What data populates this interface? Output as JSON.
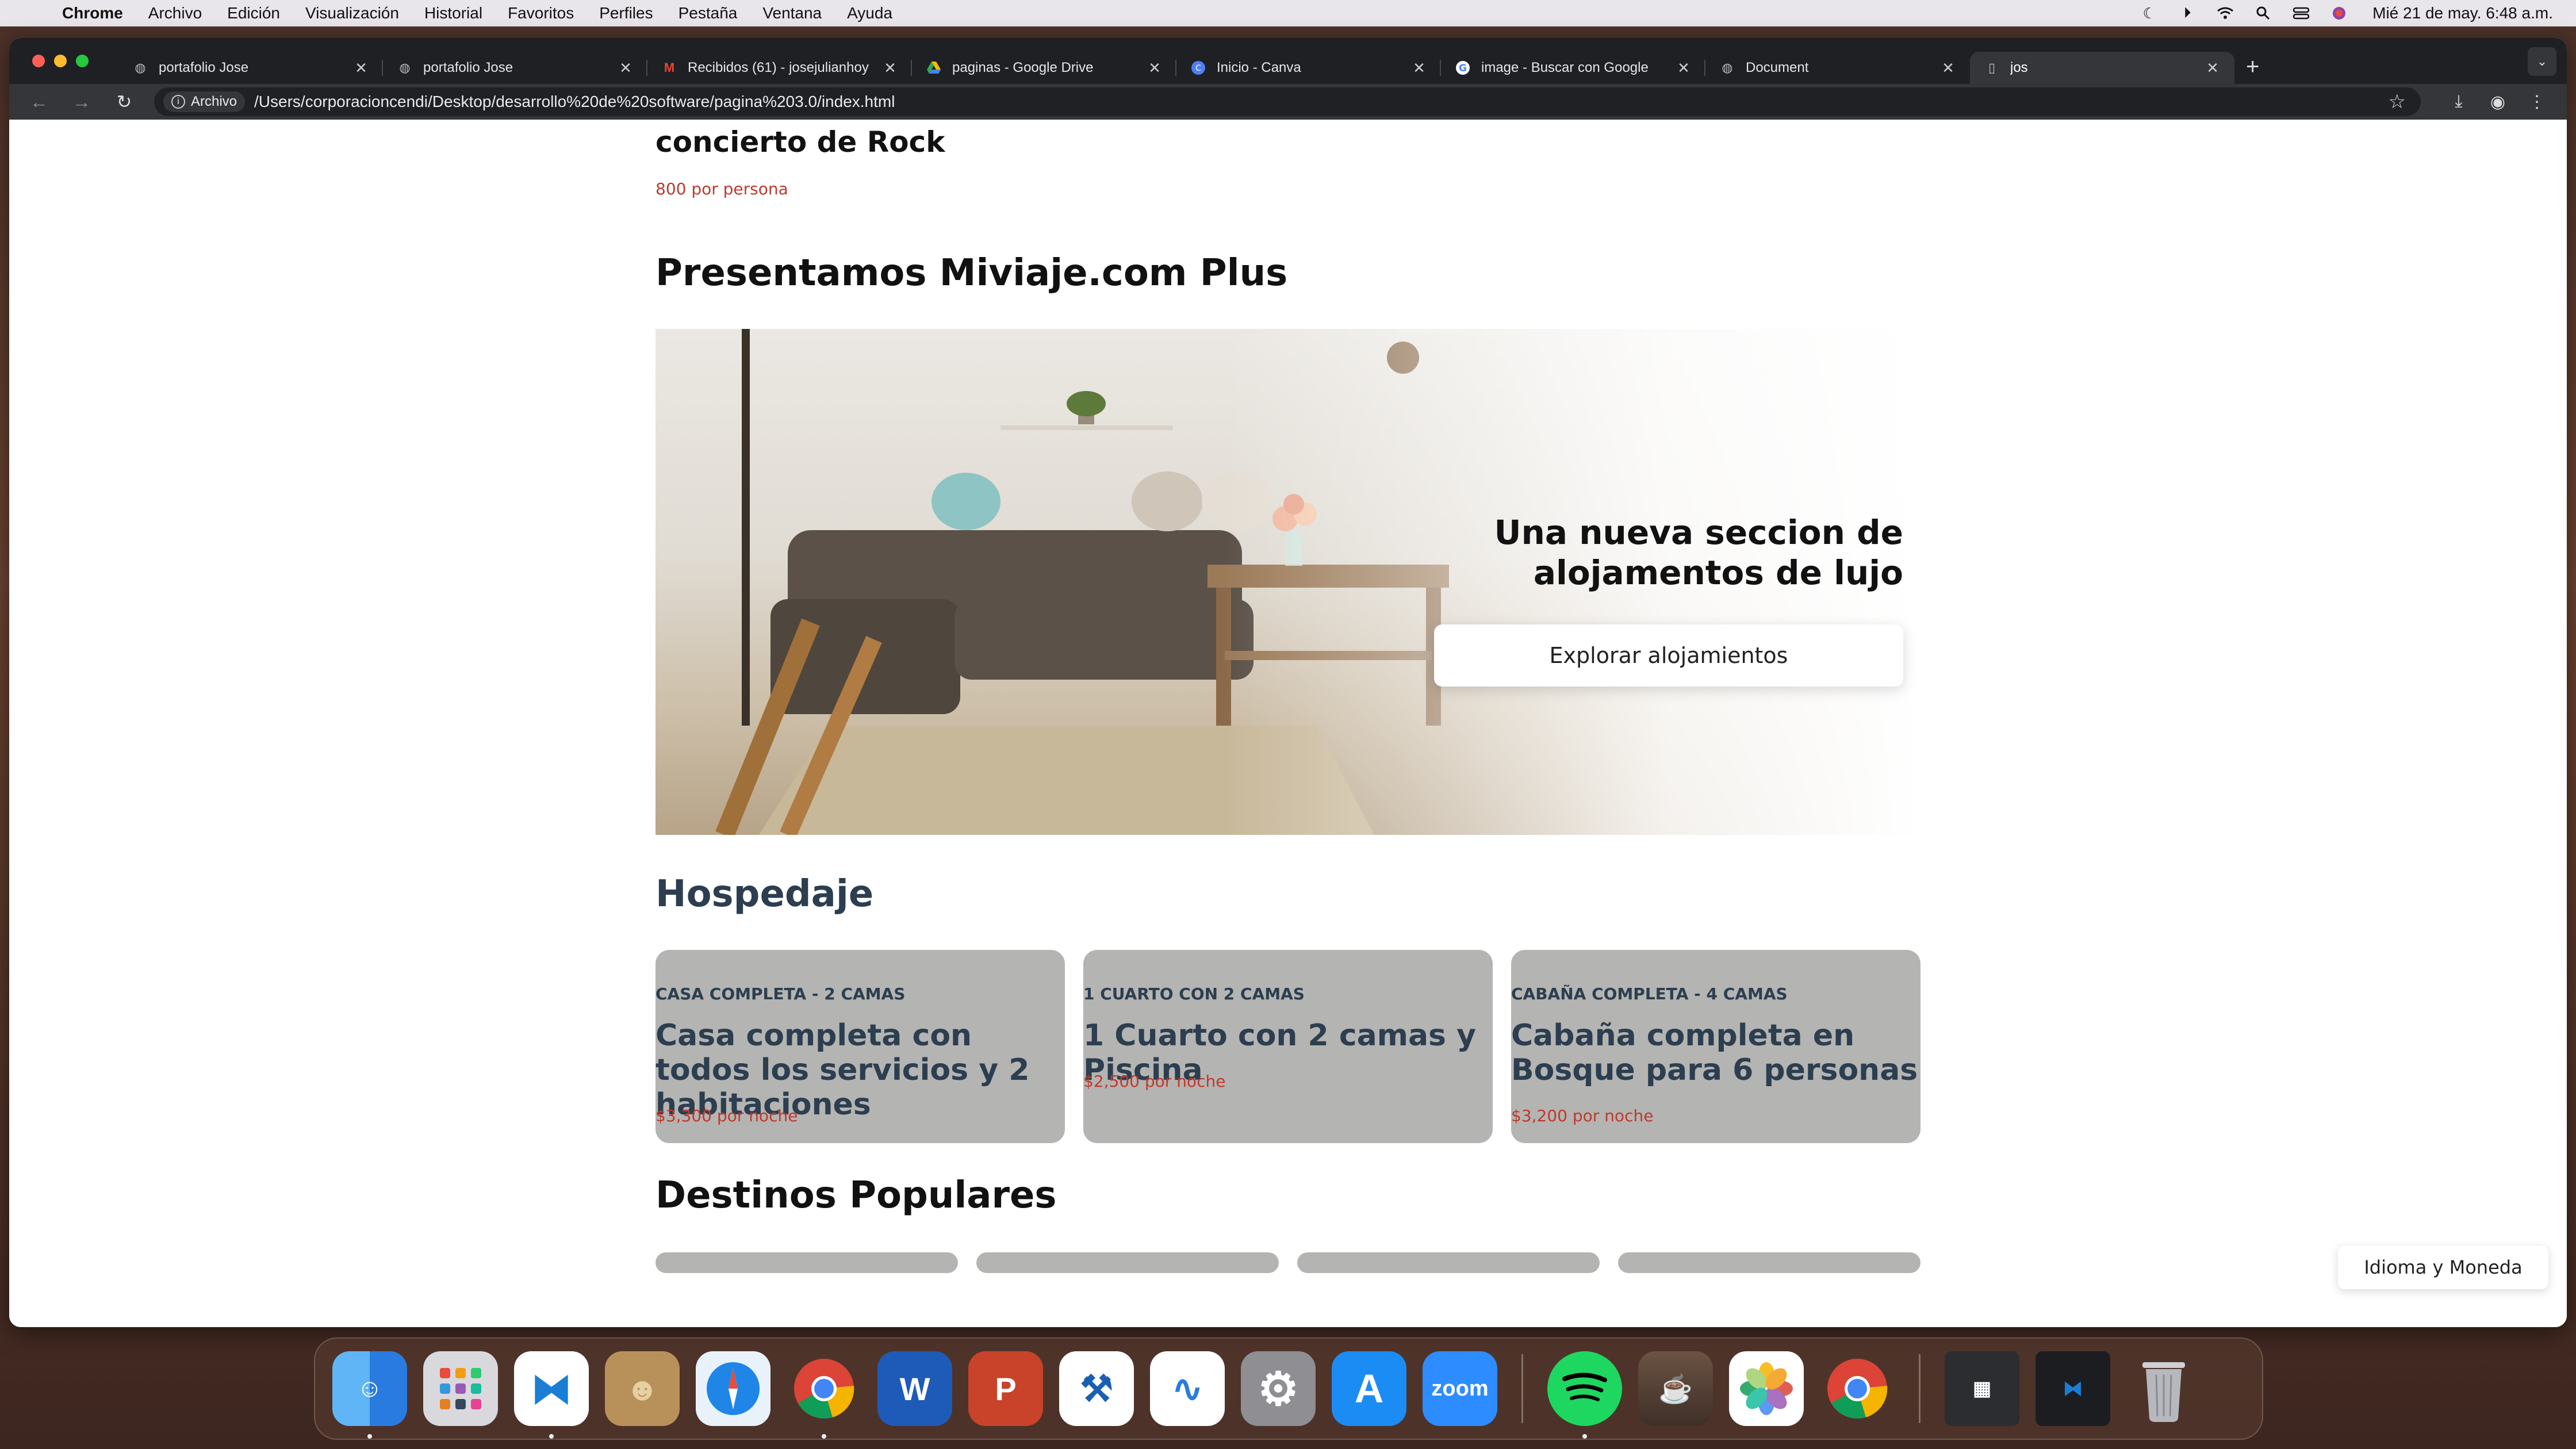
{
  "menubar": {
    "items": [
      "Chrome",
      "Archivo",
      "Edición",
      "Visualización",
      "Historial",
      "Favoritos",
      "Perfiles",
      "Pestaña",
      "Ventana",
      "Ayuda"
    ],
    "clock": "Mié 21 de may.  6:48 a.m."
  },
  "tabs": [
    {
      "title": "portafolio Jose",
      "icon": "globe-icon"
    },
    {
      "title": "portafolio Jose",
      "icon": "globe-icon"
    },
    {
      "title": "Recibidos (61) - josejulianhoy",
      "icon": "gmail-icon"
    },
    {
      "title": "paginas - Google Drive",
      "icon": "drive-icon"
    },
    {
      "title": "Inicio - Canva",
      "icon": "canva-icon"
    },
    {
      "title": "image - Buscar con Google",
      "icon": "google-icon"
    },
    {
      "title": "Document",
      "icon": "globe-icon"
    },
    {
      "title": "jos",
      "icon": "file-icon"
    }
  ],
  "toolbar": {
    "chip_label": "Archivo",
    "url": "/Users/corporacioncendi/Desktop/desarrollo%20de%20software/pagina%203.0/index.html"
  },
  "page": {
    "event": {
      "title": "concierto de Rock",
      "price": "800 por persona"
    },
    "plus": {
      "heading": "Presentamos Miviaje.com Plus",
      "hero_title": "Una nueva seccion de alojamentos de lujo",
      "hero_button": "Explorar alojamientos"
    },
    "hospedaje": {
      "heading": "Hospedaje",
      "cards": [
        {
          "type": "CASA COMPLETA - 2 CAMAS",
          "title": "Casa completa con todos los servicios y 2 habitaciones",
          "price": "$3,300 por noche"
        },
        {
          "type": "1 CUARTO CON 2 CAMAS",
          "title": "1 Cuarto con 2 camas y Piscina",
          "price": "$2,500 por noche"
        },
        {
          "type": "CABAÑA COMPLETA - 4 CAMAS",
          "title": "Cabaña completa en Bosque para 6 personas",
          "price": "$3,200 por noche"
        }
      ]
    },
    "destinos": {
      "heading": "Destinos Populares"
    },
    "lang_button": "Idioma y Moneda"
  },
  "dock": {
    "apps": [
      "Finder",
      "Launchpad",
      "Visual Studio Code",
      "Contacts",
      "Safari",
      "Chrome",
      "Word",
      "PowerPoint",
      "Xcode Instruments",
      "Freeform",
      "System Settings",
      "App Store",
      "zoom",
      "Spotify",
      "Notes Widget",
      "Photos",
      "Chrome 2"
    ],
    "zoom_label": "zoom"
  },
  "colors": {
    "price_red": "#c0392b",
    "heading_navy": "#2c3e50",
    "card_gray": "#b4b4b2"
  }
}
